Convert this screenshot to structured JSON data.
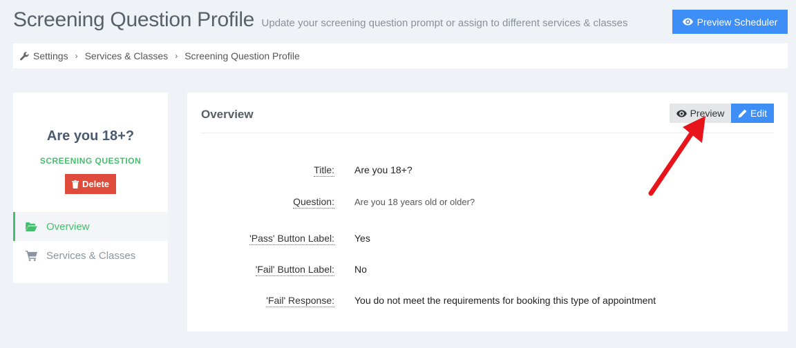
{
  "header": {
    "title": "Screening Question Profile",
    "subtitle": "Update your screening question prompt or assign to different services & classes",
    "preview_scheduler_label": "Preview Scheduler"
  },
  "breadcrumb": [
    "Settings",
    "Services & Classes",
    "Screening Question Profile"
  ],
  "sidebar": {
    "name": "Are you 18+?",
    "type": "SCREENING QUESTION",
    "delete_label": "Delete",
    "nav": [
      {
        "label": "Overview",
        "icon": "folder-open-icon",
        "active": true
      },
      {
        "label": "Services & Classes",
        "icon": "cart-icon",
        "active": false
      }
    ]
  },
  "overview": {
    "title": "Overview",
    "preview_label": "Preview",
    "edit_label": "Edit",
    "fields": [
      {
        "label": "Title:",
        "value": "Are you 18+?"
      },
      {
        "label": "Question:",
        "value": "Are you 18 years old or older?"
      },
      {
        "label": "'Pass' Button Label:",
        "value": "Yes"
      },
      {
        "label": "'Fail' Button Label:",
        "value": "No"
      },
      {
        "label": "'Fail' Response:",
        "value": "You do not meet the requirements for booking this type of appointment"
      }
    ]
  },
  "colors": {
    "accent_blue": "#3e8ef7",
    "success_green": "#46be6e",
    "danger_red": "#df4a3a",
    "annotation_red": "#e8141b"
  }
}
